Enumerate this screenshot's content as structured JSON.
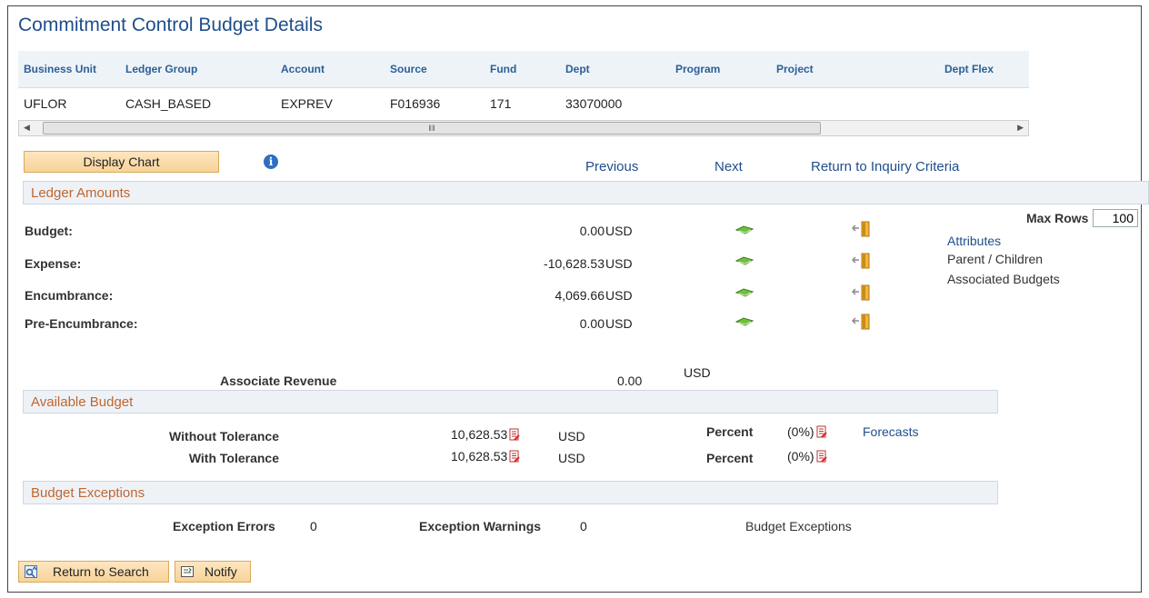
{
  "page": {
    "title": "Commitment Control Budget Details"
  },
  "grid": {
    "headers": [
      "Business Unit",
      "Ledger Group",
      "Account",
      "Source",
      "Fund",
      "Dept",
      "Program",
      "Project",
      "Dept Flex"
    ],
    "row": [
      "UFLOR",
      "CASH_BASED",
      "EXPREV",
      "F016936",
      "171",
      "33070000",
      "",
      "",
      ""
    ]
  },
  "toolbar": {
    "display_chart": "Display Chart",
    "info_icon": "info-icon",
    "previous": "Previous",
    "next": "Next",
    "return_inquiry": "Return to Inquiry Criteria"
  },
  "ledger": {
    "heading": "Ledger Amounts",
    "rows": [
      {
        "label": "Budget:",
        "amount": "0.00",
        "currency": "USD"
      },
      {
        "label": "Expense:",
        "amount": "-10,628.53",
        "currency": "USD"
      },
      {
        "label": "Encumbrance:",
        "amount": "4,069.66",
        "currency": "USD"
      },
      {
        "label": "Pre-Encumbrance:",
        "amount": "0.00",
        "currency": "USD"
      }
    ],
    "max_rows_label": "Max Rows",
    "max_rows_value": "100",
    "attributes_link": "Attributes",
    "parent_children": "Parent / Children",
    "associated_budgets": "Associated Budgets",
    "associate_revenue_label": "Associate Revenue",
    "associate_revenue_amount": "0.00",
    "associate_revenue_currency": "USD"
  },
  "available": {
    "heading": "Available Budget",
    "without_label": "Without Tolerance",
    "without_amount": "10,628.53",
    "without_currency": "USD",
    "with_label": "With Tolerance",
    "with_amount": "10,628.53",
    "with_currency": "USD",
    "percent_label": "Percent",
    "percent_value": "(0%)",
    "forecasts_link": "Forecasts"
  },
  "exceptions": {
    "heading": "Budget Exceptions",
    "errors_label": "Exception Errors",
    "errors_value": "0",
    "warnings_label": "Exception Warnings",
    "warnings_value": "0",
    "budget_exceptions": "Budget Exceptions"
  },
  "footer": {
    "return_search": "Return to Search",
    "notify": "Notify"
  },
  "colors": {
    "title": "#1f4e8c",
    "section_heading": "#c0662f",
    "button_bg": "#f7d398"
  }
}
